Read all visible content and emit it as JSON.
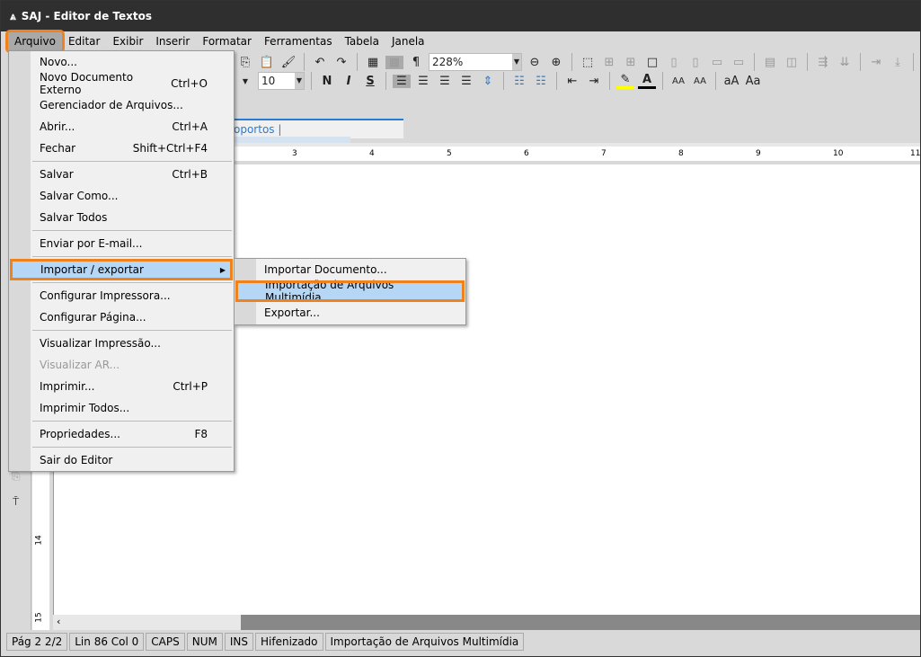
{
  "window": {
    "title": "SAJ - Editor de Textos",
    "logo": "saj-logo-icon"
  },
  "menubar": [
    "Arquivo",
    "Editar",
    "Exibir",
    "Inserir",
    "Formatar",
    "Ferramentas",
    "Tabela",
    "Janela"
  ],
  "toolbar": {
    "zoom": "228%",
    "font_size": "10",
    "bold": "N",
    "italic": "I",
    "underline": "S",
    "pilcrow": "¶"
  },
  "tab": {
    "label": "oportos |"
  },
  "ruler": {
    "h": [
      "3",
      "4",
      "5",
      "6",
      "7",
      "8",
      "9",
      "10",
      "11"
    ],
    "v": [
      "14",
      "15"
    ]
  },
  "file_menu": [
    {
      "label": "Novo...",
      "shortcut": ""
    },
    {
      "label": "Novo Documento Externo",
      "shortcut": "Ctrl+O"
    },
    {
      "label": "Gerenciador de Arquivos...",
      "shortcut": ""
    },
    {
      "label": "Abrir...",
      "shortcut": "Ctrl+A"
    },
    {
      "label": "Fechar",
      "shortcut": "Shift+Ctrl+F4"
    },
    {
      "sep": true
    },
    {
      "label": "Salvar",
      "shortcut": "Ctrl+B"
    },
    {
      "label": "Salvar Como...",
      "shortcut": ""
    },
    {
      "label": "Salvar Todos",
      "shortcut": ""
    },
    {
      "sep": true
    },
    {
      "label": "Enviar por E-mail...",
      "shortcut": ""
    },
    {
      "sep": true
    },
    {
      "label": "Importar / exportar",
      "shortcut": "",
      "submenu": true,
      "highlighted": true
    },
    {
      "sep": true
    },
    {
      "label": "Configurar Impressora...",
      "shortcut": ""
    },
    {
      "label": "Configurar Página...",
      "shortcut": ""
    },
    {
      "sep": true
    },
    {
      "label": "Visualizar Impressão...",
      "shortcut": ""
    },
    {
      "label": "Visualizar AR...",
      "shortcut": "",
      "disabled": true
    },
    {
      "label": "Imprimir...",
      "shortcut": "Ctrl+P"
    },
    {
      "label": "Imprimir Todos...",
      "shortcut": ""
    },
    {
      "sep": true
    },
    {
      "label": "Propriedades...",
      "shortcut": "F8"
    },
    {
      "sep": true
    },
    {
      "label": "Sair do Editor",
      "shortcut": ""
    }
  ],
  "submenu": [
    {
      "label": "Importar Documento..."
    },
    {
      "label": "Importação de Arquivos Multimídia...",
      "highlighted": true
    },
    {
      "label": "Exportar..."
    }
  ],
  "status": [
    "Pág 2   2/2",
    "Lin 86  Col 0",
    "CAPS",
    "NUM",
    "INS",
    "Hifenizado",
    "Importação de Arquivos Multimídia"
  ],
  "colors": {
    "highlight_outline": "#f0821e",
    "selection": "#b5d7f5",
    "titlebar": "#2f2f2f",
    "accent": "#2a7bd4"
  }
}
